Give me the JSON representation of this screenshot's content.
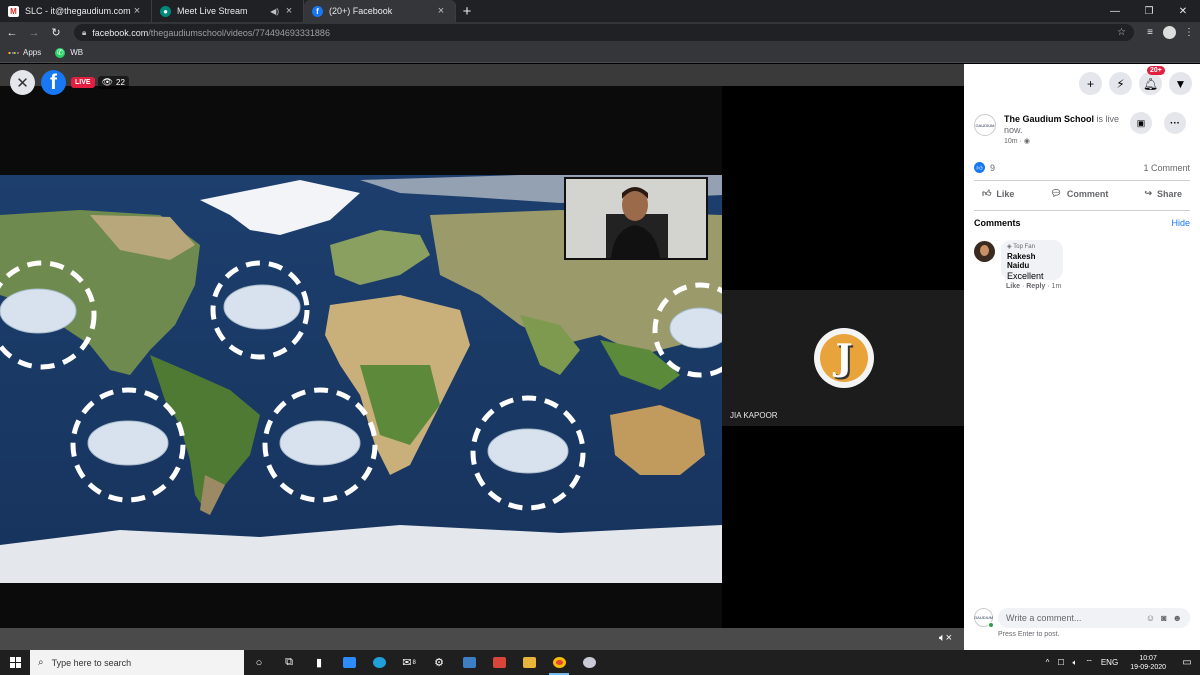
{
  "browser": {
    "tabs": [
      {
        "title": "SLC - it@thegaudium.com - Gau",
        "favicon": "gmail-icon",
        "active": false
      },
      {
        "title": "Meet Live Stream",
        "favicon": "meet-icon",
        "active": false
      },
      {
        "title": "(20+) Facebook",
        "favicon": "facebook-icon",
        "active": true
      }
    ],
    "url_host": "facebook.com",
    "url_path": "/thegaudiumschool/videos/774494693331886",
    "bookmarks": [
      {
        "label": "Apps",
        "icon": "apps-grid-icon"
      },
      {
        "label": "WB",
        "icon": "whatsapp-icon"
      }
    ]
  },
  "video": {
    "live_label": "LIVE",
    "viewer_count": "22",
    "participant_name": "JIA KAPOOR",
    "participant_initial": "J"
  },
  "fb": {
    "notif_badge": "20+",
    "page_name": "The Gaudium School",
    "post_status": "is live now.",
    "post_time": "10m ·",
    "page_logo_text": "GAUDIUM",
    "likes_count": "9",
    "comments_count": "1 Comment",
    "actions": {
      "like": "Like",
      "comment": "Comment",
      "share": "Share"
    },
    "comments_header": "Comments",
    "hide_label": "Hide",
    "comment": {
      "badge": "Top Fan",
      "author": "Rakesh Naidu",
      "text": "Excellent",
      "like": "Like",
      "reply": "Reply",
      "time": "1m"
    },
    "write_placeholder": "Write a comment...",
    "enter_hint": "Press Enter to post."
  },
  "taskbar": {
    "search_placeholder": "Type here to search",
    "lang": "ENG",
    "time": "10:07",
    "date": "19-09-2020",
    "mail_badge": "8"
  }
}
